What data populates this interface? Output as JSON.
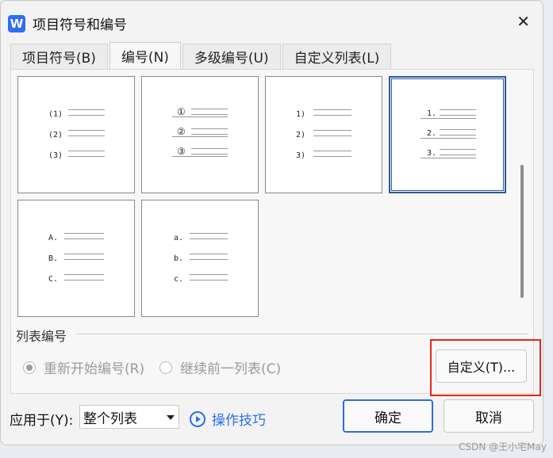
{
  "app": {
    "icon_letter": "W",
    "title": "项目符号和编号"
  },
  "tabs": [
    {
      "label": "项目符号(B)"
    },
    {
      "label": "编号(N)"
    },
    {
      "label": "多级编号(U)"
    },
    {
      "label": "自定义列表(L)"
    }
  ],
  "active_tab": 1,
  "gallery": {
    "items": [
      {
        "markers": [
          "(1)",
          "(2)",
          "(3)"
        ]
      },
      {
        "markers": [
          "①",
          "②",
          "③"
        ]
      },
      {
        "markers": [
          "1)",
          "2)",
          "3)"
        ]
      },
      {
        "markers": [
          "1.",
          "2.",
          "3."
        ]
      },
      {
        "markers": [
          "A.",
          "B.",
          "C."
        ]
      },
      {
        "markers": [
          "a.",
          "b.",
          "c."
        ]
      }
    ],
    "selected_index": 3
  },
  "list_numbering": {
    "section_title": "列表编号",
    "restart_label": "重新开始编号(R)",
    "continue_label": "继续前一列表(C)",
    "selected": "restart",
    "custom_button": "自定义(T)..."
  },
  "footer": {
    "apply_label": "应用于(Y):",
    "apply_value": "整个列表",
    "tips_label": "操作技巧",
    "ok_label": "确定",
    "cancel_label": "取消"
  },
  "watermark": "CSDN @王小宅May",
  "colors": {
    "accent": "#2b6fe8",
    "highlight": "#e3261c",
    "selected_border": "#2b579a"
  }
}
